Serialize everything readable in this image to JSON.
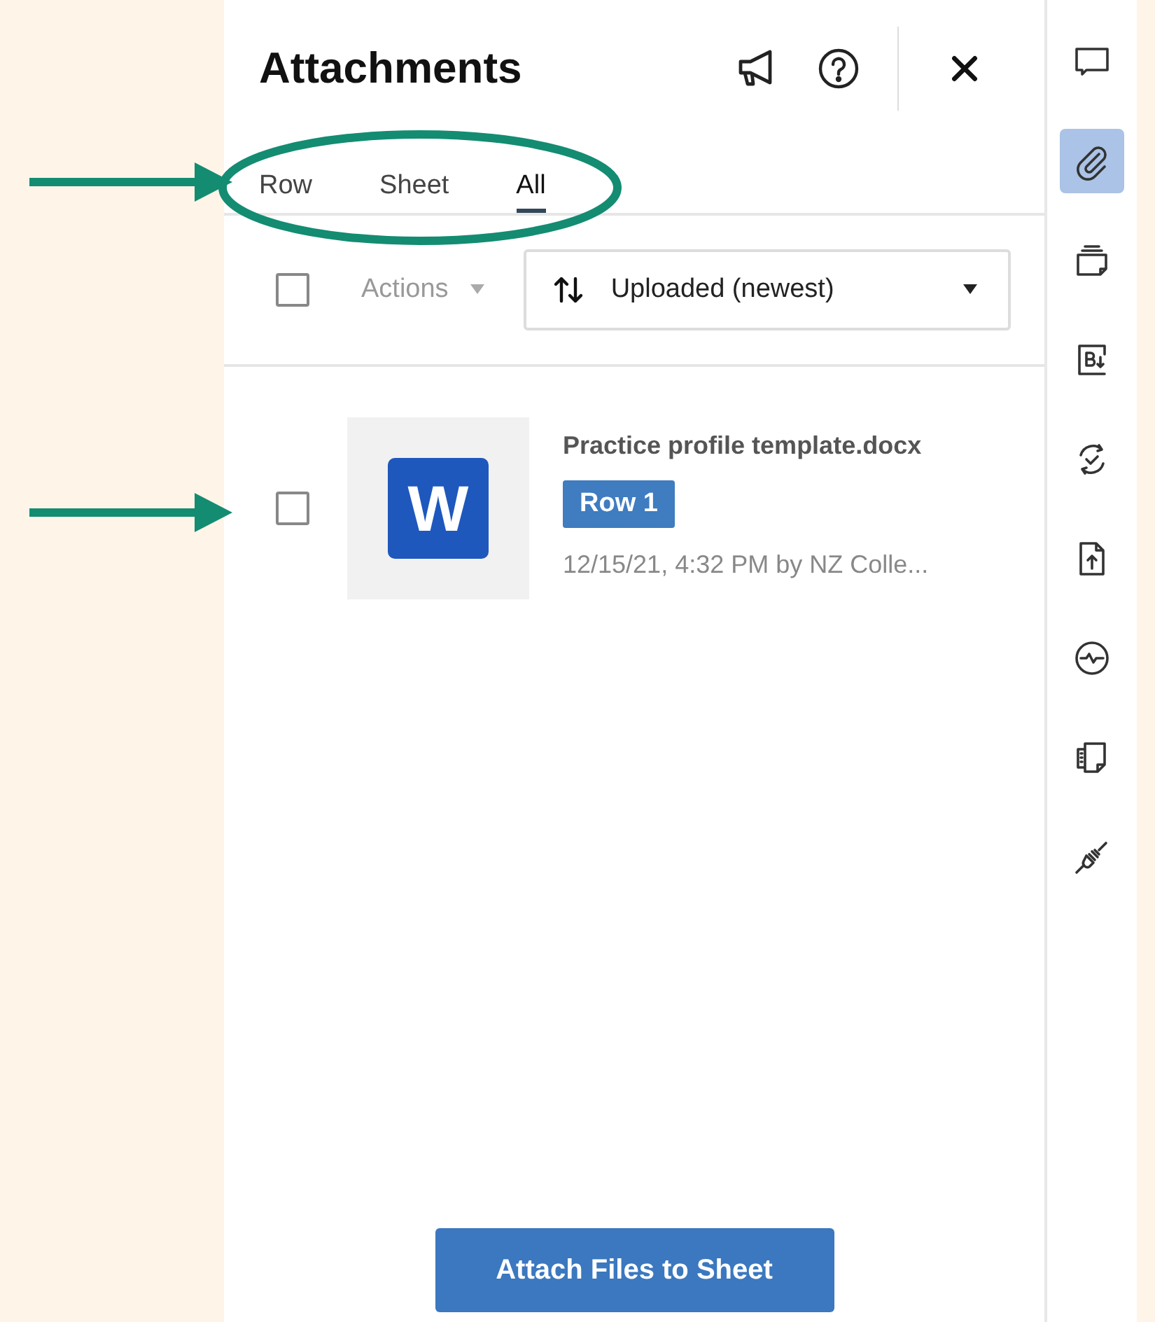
{
  "panel": {
    "title": "Attachments"
  },
  "tabs": [
    {
      "label": "Row",
      "selected": false
    },
    {
      "label": "Sheet",
      "selected": false
    },
    {
      "label": "All",
      "selected": true
    }
  ],
  "toolbar": {
    "select_all_checked": false,
    "actions_label": "Actions",
    "sort": {
      "value": "Uploaded (newest)"
    }
  },
  "attachments": [
    {
      "checked": false,
      "file_letter": "W",
      "name": "Practice profile template.docx",
      "tag": "Row 1",
      "meta": "12/15/21, 4:32 PM by NZ Colle..."
    }
  ],
  "attach_button": "Attach Files to Sheet",
  "rail": [
    {
      "kind": "comment",
      "selected": false
    },
    {
      "kind": "paperclip",
      "selected": true
    },
    {
      "kind": "cards",
      "selected": false
    },
    {
      "kind": "bold-download",
      "selected": false
    },
    {
      "kind": "sync-check",
      "selected": false
    },
    {
      "kind": "file-upload",
      "selected": false
    },
    {
      "kind": "activity",
      "selected": false
    },
    {
      "kind": "document",
      "selected": false
    },
    {
      "kind": "plug",
      "selected": false
    }
  ]
}
